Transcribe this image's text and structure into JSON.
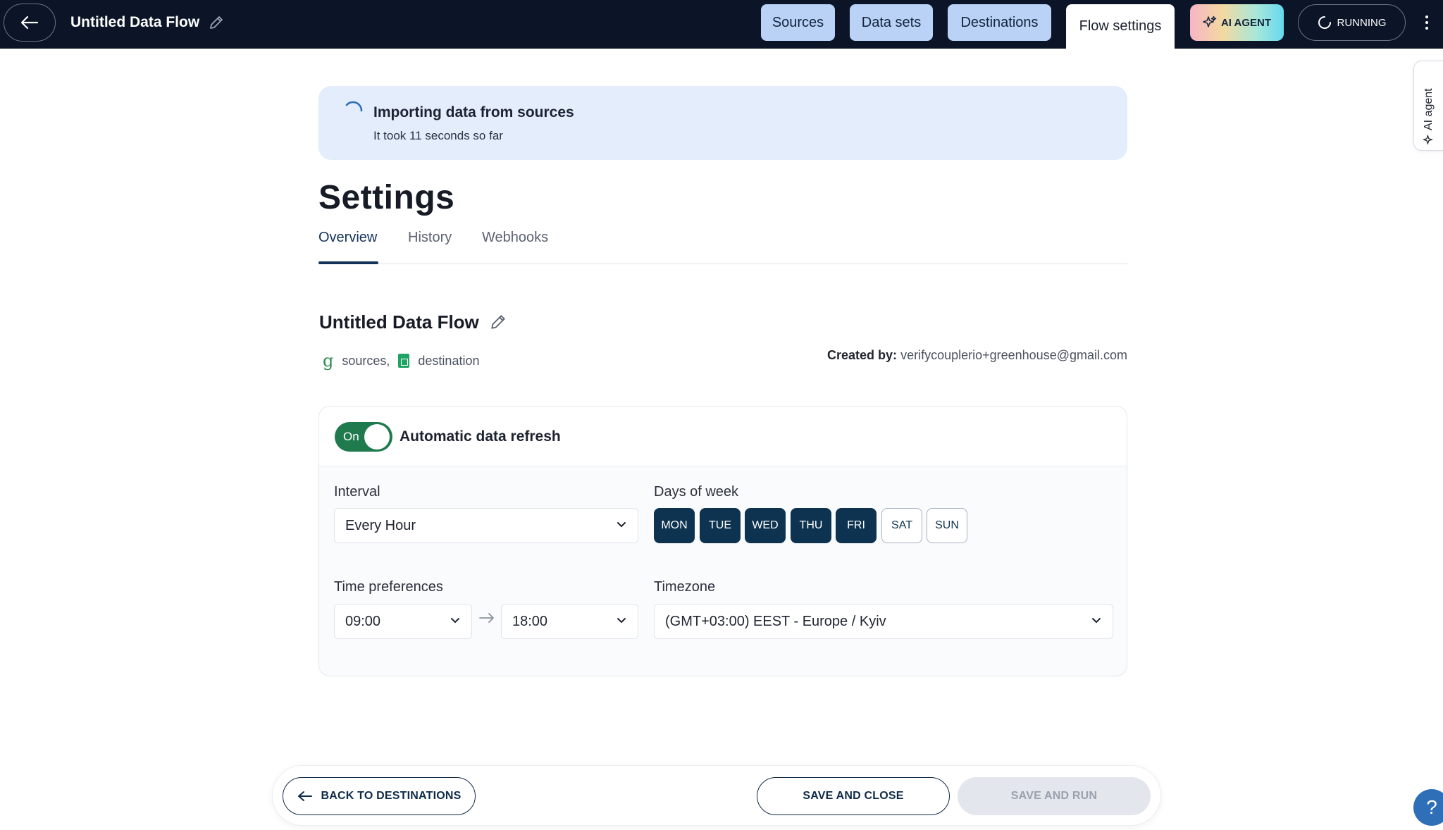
{
  "topbar": {
    "flow_title": "Untitled Data Flow",
    "tabs": [
      {
        "label": "Sources"
      },
      {
        "label": "Data sets"
      },
      {
        "label": "Destinations"
      },
      {
        "label": "Flow settings"
      }
    ],
    "active_tab": "Flow settings",
    "ai_agent_label": "AI AGENT",
    "status_label": "RUNNING",
    "bar_color": "#0b1527",
    "tab_color": "#b9d2f5"
  },
  "side_panel": {
    "label": "AI agent"
  },
  "banner": {
    "title": "Importing data from sources",
    "subtitle": "It took 11 seconds so far"
  },
  "page": {
    "title": "Settings",
    "tabs": [
      {
        "label": "Overview"
      },
      {
        "label": "History"
      },
      {
        "label": "Webhooks"
      }
    ],
    "active_tab": "Overview"
  },
  "flow": {
    "name": "Untitled Data Flow",
    "sources_text": "sources,",
    "destination_text": "destination",
    "created_by_label": "Created by:",
    "created_by_value": "verifycouplerio+greenhouse@gmail.com"
  },
  "refresh": {
    "toggle_label": "On",
    "enabled": true,
    "title": "Automatic data refresh",
    "interval_label": "Interval",
    "interval_value": "Every Hour",
    "days_label": "Days of week",
    "days": [
      {
        "label": "MON",
        "selected": true
      },
      {
        "label": "TUE",
        "selected": true
      },
      {
        "label": "WED",
        "selected": true
      },
      {
        "label": "THU",
        "selected": true
      },
      {
        "label": "FRI",
        "selected": true
      },
      {
        "label": "SAT",
        "selected": false
      },
      {
        "label": "SUN",
        "selected": false
      }
    ],
    "time_label": "Time preferences",
    "time_from": "09:00",
    "time_to": "18:00",
    "timezone_label": "Timezone",
    "timezone_value": "(GMT+03:00) EEST - Europe / Kyiv",
    "accent_color": "#0e3350",
    "toggle_color": "#1f7a4d"
  },
  "footer": {
    "back_label": "BACK TO DESTINATIONS",
    "save_close_label": "SAVE AND CLOSE",
    "save_run_label": "SAVE AND RUN"
  },
  "help": {
    "label": "?"
  }
}
